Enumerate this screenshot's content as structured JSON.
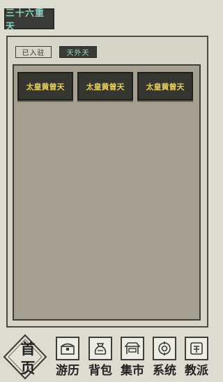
{
  "header": {
    "title": "三十六重天"
  },
  "filters": [
    {
      "label": "已入驻"
    },
    {
      "label": "天外天"
    }
  ],
  "cards": [
    {
      "label": "太皇黄曾天"
    },
    {
      "label": "太皇黄曾天"
    },
    {
      "label": "太皇黄曾天"
    }
  ],
  "nav": {
    "home_top": "首",
    "home_bottom": "页",
    "items": [
      {
        "label": "游历",
        "icon": "chest-icon"
      },
      {
        "label": "背包",
        "icon": "bag-icon"
      },
      {
        "label": "集市",
        "icon": "stall-icon"
      },
      {
        "label": "系统",
        "icon": "settings-icon"
      },
      {
        "label": "教派",
        "icon": "sect-icon"
      }
    ]
  }
}
